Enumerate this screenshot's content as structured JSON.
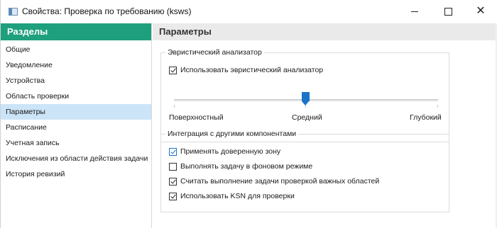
{
  "window": {
    "title": "Свойства: Проверка по требованию (ksws)",
    "minimize_icon": "minimize-icon",
    "maximize_icon": "maximize-icon",
    "close_icon": "close-icon"
  },
  "sidebar": {
    "header": "Разделы",
    "items": [
      {
        "label": "Общие",
        "active": false
      },
      {
        "label": "Уведомление",
        "active": false
      },
      {
        "label": "Устройства",
        "active": false
      },
      {
        "label": "Область проверки",
        "active": false
      },
      {
        "label": "Параметры",
        "active": true
      },
      {
        "label": "Расписание",
        "active": false
      },
      {
        "label": "Учетная запись",
        "active": false
      },
      {
        "label": "Исключения из области действия задачи",
        "active": false
      },
      {
        "label": "История ревизий",
        "active": false
      }
    ]
  },
  "main": {
    "header": "Параметры",
    "heuristic": {
      "legend": "Эвристический анализатор",
      "use_checkbox": {
        "label": "Использовать эвристический анализатор",
        "checked": true
      },
      "slider": {
        "levels": [
          "Поверхностный",
          "Средний",
          "Глубокий"
        ],
        "selected": "Средний"
      }
    },
    "integration": {
      "legend": "Интеграция с другими компонентами",
      "options": [
        {
          "label": "Применять доверенную зону",
          "checked": true
        },
        {
          "label": "Выполнять задачу в фоновом режиме",
          "checked": false
        },
        {
          "label": "Считать выполнение задачи проверкой важных областей",
          "checked": true
        },
        {
          "label": "Использовать KSN для проверки",
          "checked": true
        }
      ]
    }
  },
  "colors": {
    "sidebar_header_bg": "#1e9f7d",
    "active_item_bg": "#cce4f7",
    "accent": "#1a73c9",
    "main_header_bg": "#eaeaea"
  }
}
